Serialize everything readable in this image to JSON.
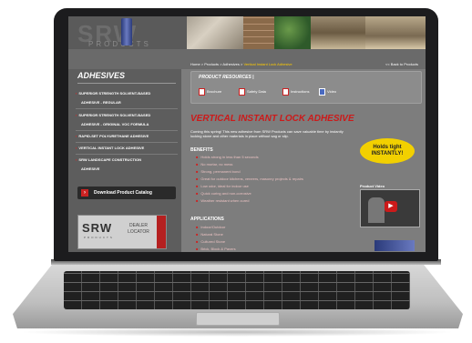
{
  "site": {
    "logo_text": "SRW",
    "logo_sub": "PRODUCTS"
  },
  "breadcrumb": {
    "home": "Home",
    "products": "Products",
    "adhesives": "Adhesives",
    "current": "Vertical Instant Lock Adhesive",
    "sep": ">",
    "back": "<< Back to Products"
  },
  "sidebar": {
    "title": "ADHESIVES",
    "items": [
      {
        "lines": [
          "SUPERIOR STRENGTH SOLVENT-BASED",
          "ADHESIVE - REGULAR"
        ]
      },
      {
        "lines": [
          "SUPERIOR STRENGTH SOLVENT-BASED",
          "ADHESIVE - ORIGINAL VOC FORMULA"
        ]
      },
      {
        "lines": [
          "RAPID-SET POLYURETHANE ADHESIVE"
        ]
      },
      {
        "lines": [
          "VERTICAL INSTANT LOCK ADHESIVE"
        ]
      },
      {
        "lines": [
          "SRW LANDSCAPE CONSTRUCTION",
          "ADHESIVE"
        ]
      }
    ],
    "catalog_label": "Download Product Catalog",
    "dealer": {
      "logo": "SRW",
      "sub": "PRODUCTS",
      "label_1": "DEALER",
      "label_2": "LOCATOR"
    }
  },
  "resources": {
    "title": "PRODUCT RESOURCES |",
    "items": [
      "Brochure",
      "Safety Data",
      "Instructions",
      "Video"
    ]
  },
  "main": {
    "heading": "VERTICAL INSTANT LOCK ADHESIVE",
    "intro": "Coming this spring! This new adhesive from SRW Products can save valuable time by instantly locking stone and other materials in place without sag or slip.",
    "benefits_title": "BENEFITS",
    "benefits": [
      "Holds strong in less than 5 seconds",
      "No mortar, no mess",
      "Strong, permanent bond",
      "Great for outdoor kitchens, veneers, masonry projects & repairs",
      "Low odor, ideal for indoor use",
      "Quick curing and non-corrosive",
      "Weather resistant when cured"
    ],
    "applications_title": "APPLICATIONS",
    "applications": [
      "Indoor/Outdoor",
      "Natural Stone",
      "Cultured Stone",
      "Brick, Block & Pavers"
    ]
  },
  "badge": {
    "line_1": "Holds tight",
    "line_2": "INSTANTLY!"
  },
  "video": {
    "label": "Product Video"
  },
  "colors": {
    "accent": "#cc1a1a",
    "badge": "#f2d000",
    "page_bg": "#7d7d7d"
  }
}
